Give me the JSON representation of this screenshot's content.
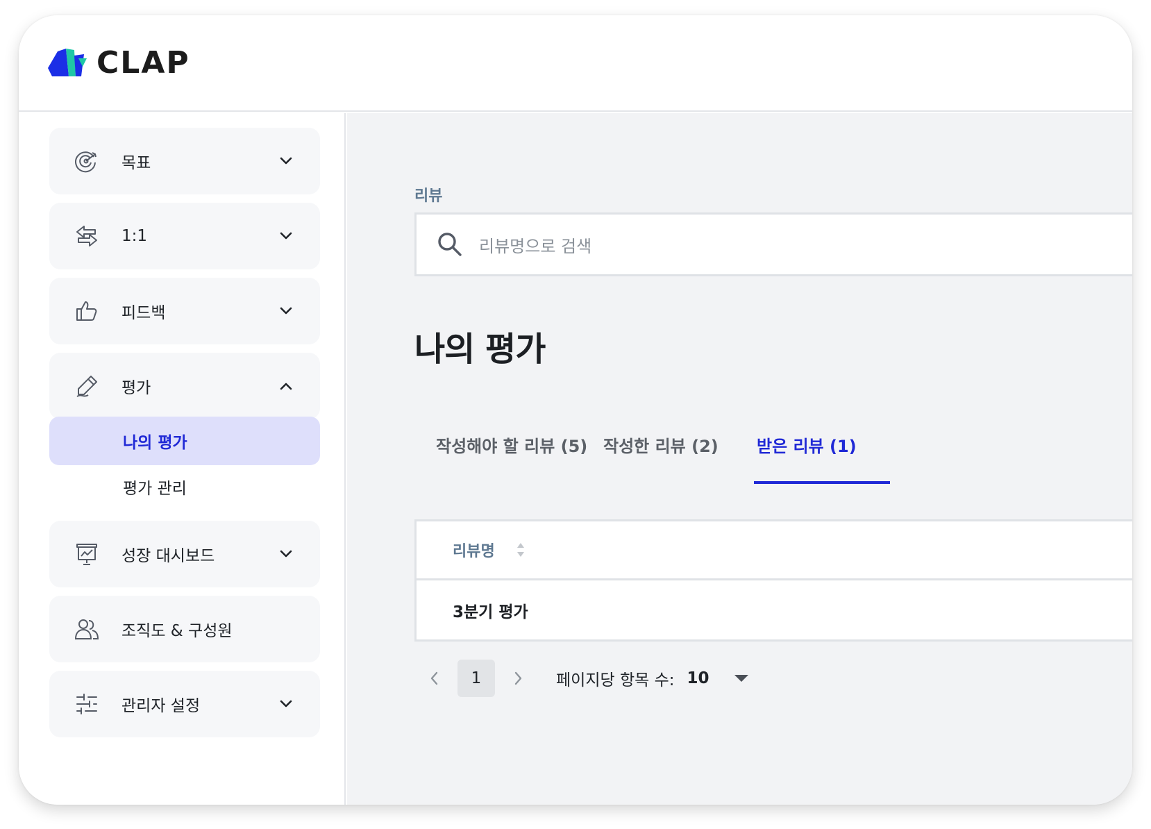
{
  "app": {
    "brand": "CLAP"
  },
  "sidebar": {
    "items": [
      {
        "label": "목표",
        "icon": "target-icon",
        "expanded": false
      },
      {
        "label": "1:1",
        "icon": "swap-arrows-icon",
        "expanded": false
      },
      {
        "label": "피드백",
        "icon": "thumbs-up-icon",
        "expanded": false
      },
      {
        "label": "평가",
        "icon": "pen-icon",
        "expanded": true
      },
      {
        "label": "성장 대시보드",
        "icon": "presentation-chart-icon",
        "expanded": false
      },
      {
        "label": "조직도 & 구성원",
        "icon": "users-icon"
      },
      {
        "label": "관리자 설정",
        "icon": "sliders-icon",
        "expanded": false
      }
    ],
    "sub_items": [
      {
        "label": "나의 평가",
        "active": true
      },
      {
        "label": "평가 관리",
        "active": false
      }
    ]
  },
  "main": {
    "breadcrumb": "리뷰",
    "search": {
      "placeholder": "리뷰명으로 검색"
    },
    "title": "나의 평가",
    "tabs": [
      {
        "label": "작성해야 할 리뷰 (5)",
        "active": false
      },
      {
        "label": "작성한 리뷰 (2)",
        "active": false
      },
      {
        "label": "받은 리뷰 (1)",
        "active": true
      }
    ],
    "table": {
      "column": "리뷰명",
      "rows": [
        "3분기 평가"
      ]
    },
    "pagination": {
      "current_page": "1",
      "per_page_label": "페이지당 항목 수:",
      "per_page_value": "10"
    }
  },
  "colors": {
    "accent": "#2029d6",
    "active_bg": "#dedffb",
    "muted_label": "#5e7891",
    "logo_blue": "#1b2ee6",
    "logo_teal": "#1fc7a6"
  }
}
